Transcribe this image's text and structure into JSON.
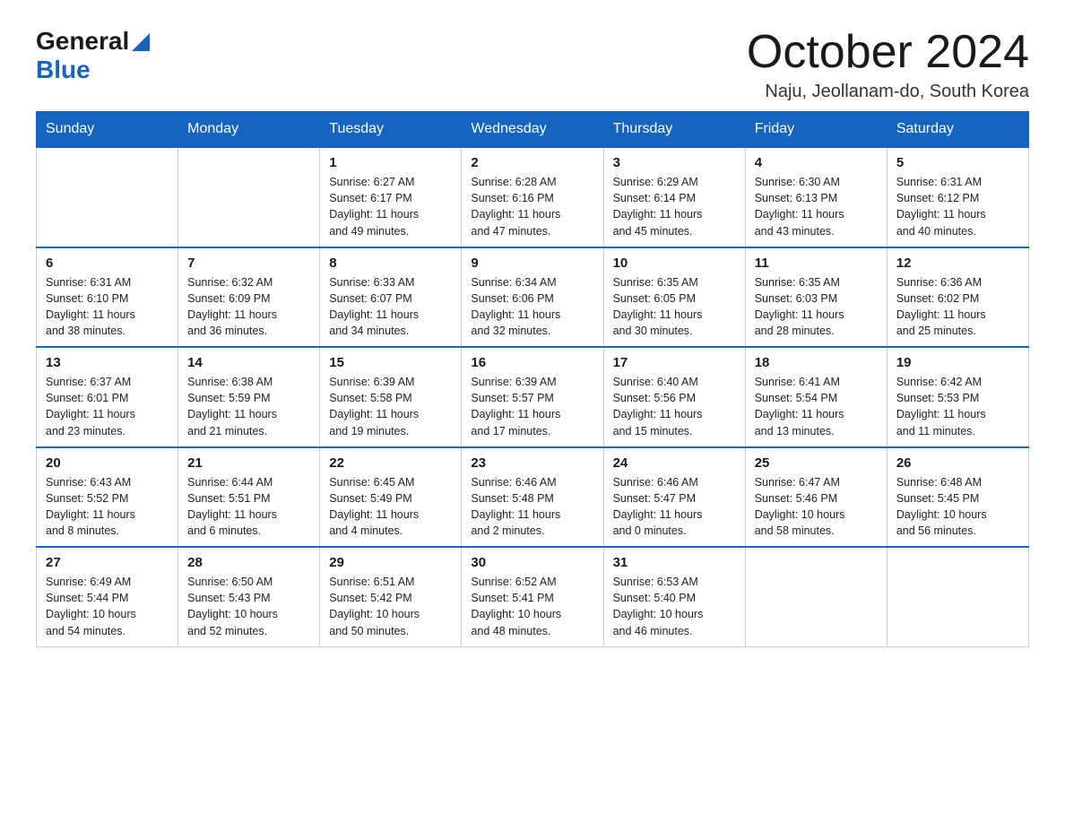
{
  "logo": {
    "general": "General",
    "triangle": "▶",
    "blue": "Blue"
  },
  "header": {
    "month": "October 2024",
    "location": "Naju, Jeollanam-do, South Korea"
  },
  "weekdays": [
    "Sunday",
    "Monday",
    "Tuesday",
    "Wednesday",
    "Thursday",
    "Friday",
    "Saturday"
  ],
  "weeks": [
    [
      {
        "day": "",
        "info": ""
      },
      {
        "day": "",
        "info": ""
      },
      {
        "day": "1",
        "info": "Sunrise: 6:27 AM\nSunset: 6:17 PM\nDaylight: 11 hours\nand 49 minutes."
      },
      {
        "day": "2",
        "info": "Sunrise: 6:28 AM\nSunset: 6:16 PM\nDaylight: 11 hours\nand 47 minutes."
      },
      {
        "day": "3",
        "info": "Sunrise: 6:29 AM\nSunset: 6:14 PM\nDaylight: 11 hours\nand 45 minutes."
      },
      {
        "day": "4",
        "info": "Sunrise: 6:30 AM\nSunset: 6:13 PM\nDaylight: 11 hours\nand 43 minutes."
      },
      {
        "day": "5",
        "info": "Sunrise: 6:31 AM\nSunset: 6:12 PM\nDaylight: 11 hours\nand 40 minutes."
      }
    ],
    [
      {
        "day": "6",
        "info": "Sunrise: 6:31 AM\nSunset: 6:10 PM\nDaylight: 11 hours\nand 38 minutes."
      },
      {
        "day": "7",
        "info": "Sunrise: 6:32 AM\nSunset: 6:09 PM\nDaylight: 11 hours\nand 36 minutes."
      },
      {
        "day": "8",
        "info": "Sunrise: 6:33 AM\nSunset: 6:07 PM\nDaylight: 11 hours\nand 34 minutes."
      },
      {
        "day": "9",
        "info": "Sunrise: 6:34 AM\nSunset: 6:06 PM\nDaylight: 11 hours\nand 32 minutes."
      },
      {
        "day": "10",
        "info": "Sunrise: 6:35 AM\nSunset: 6:05 PM\nDaylight: 11 hours\nand 30 minutes."
      },
      {
        "day": "11",
        "info": "Sunrise: 6:35 AM\nSunset: 6:03 PM\nDaylight: 11 hours\nand 28 minutes."
      },
      {
        "day": "12",
        "info": "Sunrise: 6:36 AM\nSunset: 6:02 PM\nDaylight: 11 hours\nand 25 minutes."
      }
    ],
    [
      {
        "day": "13",
        "info": "Sunrise: 6:37 AM\nSunset: 6:01 PM\nDaylight: 11 hours\nand 23 minutes."
      },
      {
        "day": "14",
        "info": "Sunrise: 6:38 AM\nSunset: 5:59 PM\nDaylight: 11 hours\nand 21 minutes."
      },
      {
        "day": "15",
        "info": "Sunrise: 6:39 AM\nSunset: 5:58 PM\nDaylight: 11 hours\nand 19 minutes."
      },
      {
        "day": "16",
        "info": "Sunrise: 6:39 AM\nSunset: 5:57 PM\nDaylight: 11 hours\nand 17 minutes."
      },
      {
        "day": "17",
        "info": "Sunrise: 6:40 AM\nSunset: 5:56 PM\nDaylight: 11 hours\nand 15 minutes."
      },
      {
        "day": "18",
        "info": "Sunrise: 6:41 AM\nSunset: 5:54 PM\nDaylight: 11 hours\nand 13 minutes."
      },
      {
        "day": "19",
        "info": "Sunrise: 6:42 AM\nSunset: 5:53 PM\nDaylight: 11 hours\nand 11 minutes."
      }
    ],
    [
      {
        "day": "20",
        "info": "Sunrise: 6:43 AM\nSunset: 5:52 PM\nDaylight: 11 hours\nand 8 minutes."
      },
      {
        "day": "21",
        "info": "Sunrise: 6:44 AM\nSunset: 5:51 PM\nDaylight: 11 hours\nand 6 minutes."
      },
      {
        "day": "22",
        "info": "Sunrise: 6:45 AM\nSunset: 5:49 PM\nDaylight: 11 hours\nand 4 minutes."
      },
      {
        "day": "23",
        "info": "Sunrise: 6:46 AM\nSunset: 5:48 PM\nDaylight: 11 hours\nand 2 minutes."
      },
      {
        "day": "24",
        "info": "Sunrise: 6:46 AM\nSunset: 5:47 PM\nDaylight: 11 hours\nand 0 minutes."
      },
      {
        "day": "25",
        "info": "Sunrise: 6:47 AM\nSunset: 5:46 PM\nDaylight: 10 hours\nand 58 minutes."
      },
      {
        "day": "26",
        "info": "Sunrise: 6:48 AM\nSunset: 5:45 PM\nDaylight: 10 hours\nand 56 minutes."
      }
    ],
    [
      {
        "day": "27",
        "info": "Sunrise: 6:49 AM\nSunset: 5:44 PM\nDaylight: 10 hours\nand 54 minutes."
      },
      {
        "day": "28",
        "info": "Sunrise: 6:50 AM\nSunset: 5:43 PM\nDaylight: 10 hours\nand 52 minutes."
      },
      {
        "day": "29",
        "info": "Sunrise: 6:51 AM\nSunset: 5:42 PM\nDaylight: 10 hours\nand 50 minutes."
      },
      {
        "day": "30",
        "info": "Sunrise: 6:52 AM\nSunset: 5:41 PM\nDaylight: 10 hours\nand 48 minutes."
      },
      {
        "day": "31",
        "info": "Sunrise: 6:53 AM\nSunset: 5:40 PM\nDaylight: 10 hours\nand 46 minutes."
      },
      {
        "day": "",
        "info": ""
      },
      {
        "day": "",
        "info": ""
      }
    ]
  ]
}
